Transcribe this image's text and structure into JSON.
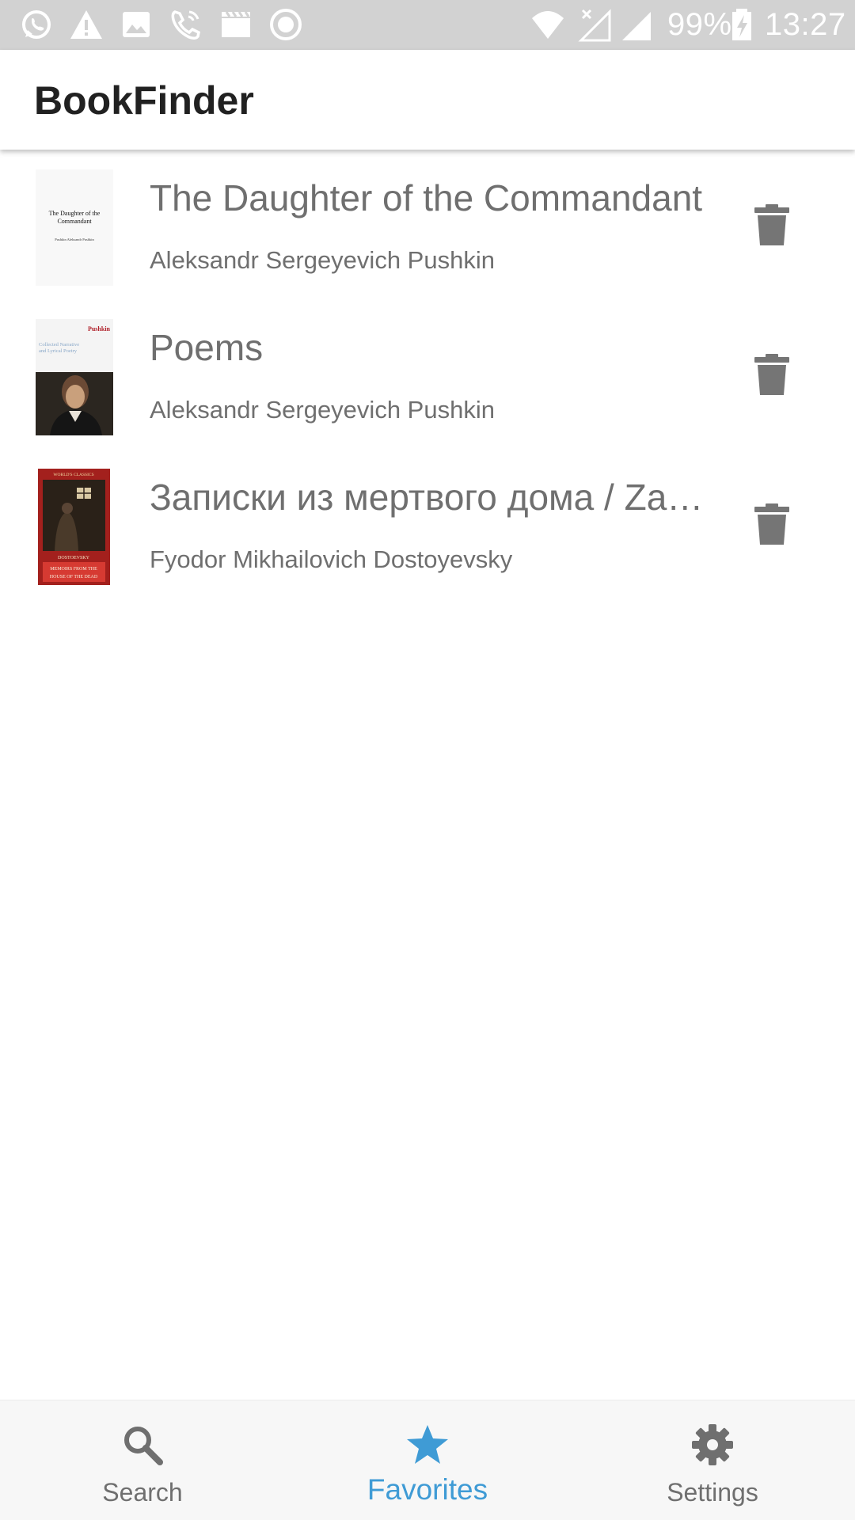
{
  "status_bar": {
    "battery": "99%",
    "time": "13:27",
    "icons_left": [
      "whatsapp-icon",
      "warning-icon",
      "image-icon",
      "call-icon",
      "video-icon",
      "record-icon"
    ],
    "icons_right": [
      "wifi-icon",
      "signal-off-icon",
      "signal-icon",
      "battery-charging-icon"
    ]
  },
  "app_bar": {
    "title": "BookFinder"
  },
  "books": [
    {
      "title": "The Daughter of the Commandant",
      "author": "Aleksandr Sergeyevich Pushkin",
      "cover_text": [
        "The Daughter of the",
        "Commandant",
        "Pushkin Aleksandr Pushkin"
      ]
    },
    {
      "title": "Poems",
      "author": "Aleksandr Sergeyevich Pushkin",
      "cover_text": [
        "Pushkin",
        "Collected Narrative",
        "and Lyrical Poetry"
      ]
    },
    {
      "title": "Записки из мертвого дома / Zapiski iz mertvogo doma",
      "author": "Fyodor Mikhailovich Dostoyevsky",
      "cover_text": [
        "WORLD'S CLASSICS",
        "DOSTOEVSKY",
        "MEMOIRS FROM THE",
        "HOUSE OF THE DEAD"
      ]
    }
  ],
  "bottom_nav": {
    "items": [
      {
        "label": "Search",
        "icon": "search-icon",
        "active": false
      },
      {
        "label": "Favorites",
        "icon": "star-icon",
        "active": true
      },
      {
        "label": "Settings",
        "icon": "gear-icon",
        "active": false
      }
    ]
  },
  "colors": {
    "status_bar_bg": "#d2d2d2",
    "accent": "#3f9bd5",
    "text_secondary": "#6f6f6f",
    "icon_gray": "#757575",
    "title_text": "#212121"
  }
}
